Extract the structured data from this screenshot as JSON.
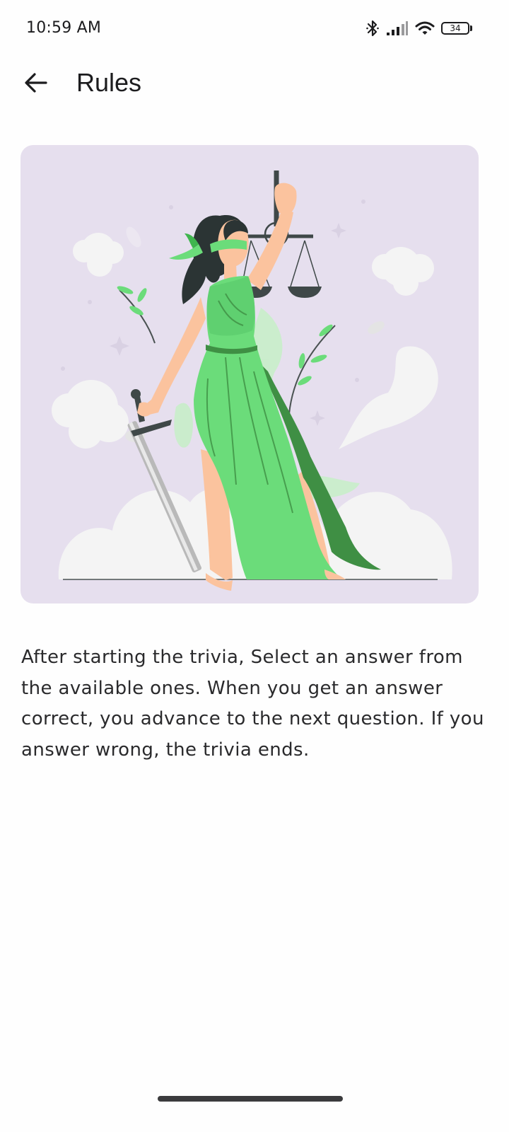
{
  "status_bar": {
    "time": "10:59 AM",
    "battery_level": "34",
    "icons": [
      "bluetooth-icon",
      "signal-icon",
      "wifi-icon",
      "battery-icon"
    ]
  },
  "app_bar": {
    "back_icon": "arrow-left-icon",
    "title": "Rules"
  },
  "hero": {
    "illustration": "lady-justice-illustration"
  },
  "rules": {
    "text": "After starting the trivia, Select an answer from the available ones. When you get an answer correct, you advance to the next question. If you answer wrong, the trivia ends."
  },
  "colors": {
    "card_background": "#e6dfee",
    "dress_green": "#6bdc7a",
    "dress_dark_green": "#3f8f44",
    "skin": "#fbc39e",
    "hair": "#2b3434",
    "cloud": "#f4f4f4"
  }
}
